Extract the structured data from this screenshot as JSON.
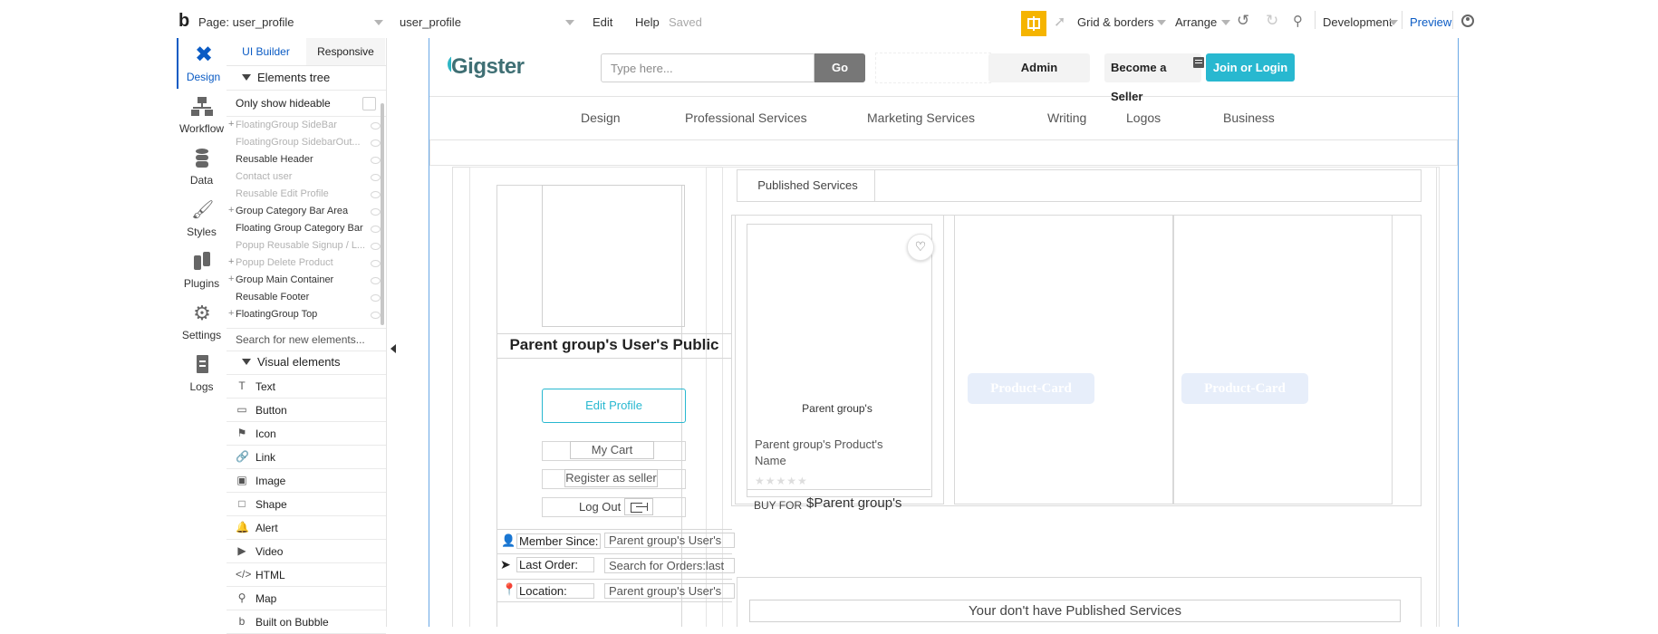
{
  "topbar": {
    "page_label": "Page: user_profile",
    "element_select": "user_profile",
    "menu_edit": "Edit",
    "menu_help": "Help",
    "save_status": "Saved",
    "grid_borders": "Grid & borders",
    "arrange": "Arrange",
    "environment": "Development",
    "preview": "Preview"
  },
  "leftnav": {
    "items": [
      {
        "label": "Design",
        "icon": "design-icon"
      },
      {
        "label": "Workflow",
        "icon": "workflow-icon"
      },
      {
        "label": "Data",
        "icon": "database-icon"
      },
      {
        "label": "Styles",
        "icon": "brush-icon"
      },
      {
        "label": "Plugins",
        "icon": "plug-icon"
      },
      {
        "label": "Settings",
        "icon": "gear-icon"
      },
      {
        "label": "Logs",
        "icon": "document-icon"
      }
    ]
  },
  "panel": {
    "tabs": [
      "UI Builder",
      "Responsive"
    ],
    "elements_tree_title": "Elements tree",
    "only_show_hideable": "Only show hideable",
    "tree": [
      {
        "name": "FloatingGroup SideBar",
        "expandable": true,
        "dim": true
      },
      {
        "name": "FloatingGroup SidebarOut...",
        "expandable": false,
        "dim": true
      },
      {
        "name": "Reusable Header",
        "expandable": false,
        "dim": false
      },
      {
        "name": "Contact user",
        "expandable": false,
        "dim": true
      },
      {
        "name": "Reusable Edit Profile",
        "expandable": false,
        "dim": true
      },
      {
        "name": "Group Category Bar Area",
        "expandable": true,
        "dim": false
      },
      {
        "name": "Floating Group Category Bar",
        "expandable": false,
        "dim": false
      },
      {
        "name": "Popup Reusable Signup / L...",
        "expandable": false,
        "dim": true
      },
      {
        "name": "Popup Delete Product",
        "expandable": true,
        "dim": true
      },
      {
        "name": "Group Main Container",
        "expandable": true,
        "dim": false
      },
      {
        "name": "Reusable Footer",
        "expandable": false,
        "dim": false
      },
      {
        "name": "FloatingGroup Top",
        "expandable": true,
        "dim": false
      }
    ],
    "search_placeholder": "Search for new elements...",
    "visual_elements_title": "Visual elements",
    "visual_elements": [
      {
        "label": "Text",
        "glyph": "T"
      },
      {
        "label": "Button",
        "glyph": "▭"
      },
      {
        "label": "Icon",
        "glyph": "⚑"
      },
      {
        "label": "Link",
        "glyph": "🔗"
      },
      {
        "label": "Image",
        "glyph": "▣"
      },
      {
        "label": "Shape",
        "glyph": "□"
      },
      {
        "label": "Alert",
        "glyph": "🔔"
      },
      {
        "label": "Video",
        "glyph": "▶"
      },
      {
        "label": "HTML",
        "glyph": "</>"
      },
      {
        "label": "Map",
        "glyph": "⚲"
      },
      {
        "label": "Built on Bubble",
        "glyph": "b"
      }
    ]
  },
  "canvas": {
    "logo_text": "Gigster",
    "search_placeholder": "Type here...",
    "go_button": "Go",
    "admin_button": "Admin",
    "become_seller": "Become a Seller",
    "join_login": "Join or Login",
    "categories": [
      "Design",
      "Professional Services",
      "Marketing Services",
      "Writing",
      "Logos",
      "Business"
    ],
    "profile_title": "Parent group's User's Public",
    "edit_profile": "Edit Profile",
    "my_cart": "My Cart",
    "register_seller": "Register as seller",
    "log_out": "Log Out",
    "member_since_label": "Member Since:",
    "member_since_value": "Parent group's User's",
    "last_order_label": "Last Order:",
    "last_order_value": "Search for Orders:last",
    "location_label": "Location:",
    "location_value": "Parent group's User's",
    "published_services_tab": "Published Services",
    "card_image_text": "Parent group's",
    "card_name": "Parent group's Product's Name",
    "buy_for": "BUY FOR",
    "card_price": "$Parent group's",
    "placeholder_card_1": "Product-Card",
    "placeholder_card_2": "Product-Card",
    "no_services": "Your don't have Published Services"
  },
  "colors": {
    "accent_blue": "#0a5bc4",
    "teal": "#28b8d0",
    "go_gray": "#777777",
    "gift_yellow": "#f5b400"
  }
}
